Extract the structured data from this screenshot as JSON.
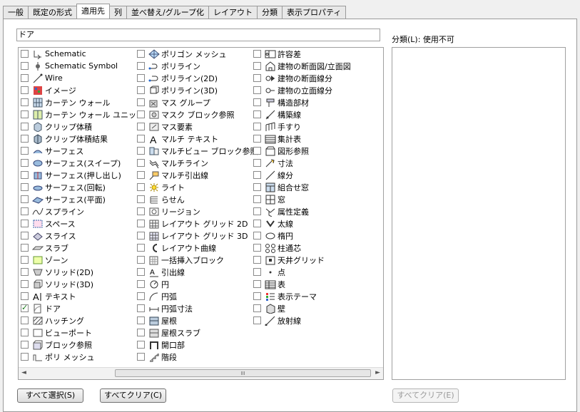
{
  "tabs": [
    "一般",
    "既定の形式",
    "適用先",
    "列",
    "並べ替え/グループ化",
    "レイアウト",
    "分類",
    "表示プロパティ"
  ],
  "active_tab": "適用先",
  "filter_value": "ドア",
  "columns": [
    [
      {
        "label": "Schematic",
        "icon": "schematic-icon",
        "checked": false
      },
      {
        "label": "Schematic Symbol",
        "icon": "schematic-symbol-icon",
        "checked": false
      },
      {
        "label": "Wire",
        "icon": "wire-icon",
        "checked": false
      },
      {
        "label": "イメージ",
        "icon": "image-icon",
        "checked": false
      },
      {
        "label": "カーテン ウォール",
        "icon": "curtain-wall-icon",
        "checked": false
      },
      {
        "label": "カーテン ウォール ユニット",
        "icon": "curtain-wall-unit-icon",
        "checked": false
      },
      {
        "label": "クリップ体積",
        "icon": "clip-volume-icon",
        "checked": false
      },
      {
        "label": "クリップ体積結果",
        "icon": "clip-volume-result-icon",
        "checked": false
      },
      {
        "label": "サーフェス",
        "icon": "surface-icon",
        "checked": false
      },
      {
        "label": "サーフェス(スイープ)",
        "icon": "surface-sweep-icon",
        "checked": false
      },
      {
        "label": "サーフェス(押し出し)",
        "icon": "surface-extrude-icon",
        "checked": false
      },
      {
        "label": "サーフェス(回転)",
        "icon": "surface-revolve-icon",
        "checked": false
      },
      {
        "label": "サーフェス(平面)",
        "icon": "surface-plane-icon",
        "checked": false
      },
      {
        "label": "スプライン",
        "icon": "spline-icon",
        "checked": false
      },
      {
        "label": "スペース",
        "icon": "space-icon",
        "checked": false
      },
      {
        "label": "スライス",
        "icon": "slice-icon",
        "checked": false
      },
      {
        "label": "スラブ",
        "icon": "slab-icon",
        "checked": false
      },
      {
        "label": "ゾーン",
        "icon": "zone-icon",
        "checked": false
      },
      {
        "label": "ソリッド(2D)",
        "icon": "solid-2d-icon",
        "checked": false
      },
      {
        "label": "ソリッド(3D)",
        "icon": "solid-3d-icon",
        "checked": false
      },
      {
        "label": "テキスト",
        "icon": "text-icon",
        "checked": false
      },
      {
        "label": "ドア",
        "icon": "door-icon",
        "checked": true
      },
      {
        "label": "ハッチング",
        "icon": "hatch-icon",
        "checked": false
      },
      {
        "label": "ビューポート",
        "icon": "viewport-icon",
        "checked": false
      },
      {
        "label": "ブロック参照",
        "icon": "block-reference-icon",
        "checked": false
      },
      {
        "label": "ポリ メッシュ",
        "icon": "poly-mesh-icon",
        "checked": false
      }
    ],
    [
      {
        "label": "ポリゴン メッシュ",
        "icon": "polygon-mesh-icon",
        "checked": false
      },
      {
        "label": "ポリライン",
        "icon": "polyline-icon",
        "checked": false
      },
      {
        "label": "ポリライン(2D)",
        "icon": "polyline-2d-icon",
        "checked": false
      },
      {
        "label": "ポリライン(3D)",
        "icon": "polyline-3d-icon",
        "checked": false
      },
      {
        "label": "マス グループ",
        "icon": "mass-group-icon",
        "checked": false
      },
      {
        "label": "マスク ブロック参照",
        "icon": "mask-block-icon",
        "checked": false
      },
      {
        "label": "マス要素",
        "icon": "mass-element-icon",
        "checked": false
      },
      {
        "label": "マルチ テキスト",
        "icon": "mtext-icon",
        "checked": false
      },
      {
        "label": "マルチビュー ブロック参照",
        "icon": "multiview-block-icon",
        "checked": false
      },
      {
        "label": "マルチライン",
        "icon": "multiline-icon",
        "checked": false
      },
      {
        "label": "マルチ引出線",
        "icon": "mleader-icon",
        "checked": false
      },
      {
        "label": "ライト",
        "icon": "light-icon",
        "checked": false
      },
      {
        "label": "らせん",
        "icon": "helix-icon",
        "checked": false
      },
      {
        "label": "リージョン",
        "icon": "region-icon",
        "checked": false
      },
      {
        "label": "レイアウト グリッド 2D",
        "icon": "layout-grid-2d-icon",
        "checked": false
      },
      {
        "label": "レイアウト グリッド 3D",
        "icon": "layout-grid-3d-icon",
        "checked": false
      },
      {
        "label": "レイアウト曲線",
        "icon": "layout-curve-icon",
        "checked": false
      },
      {
        "label": "一括挿入ブロック",
        "icon": "minsert-block-icon",
        "checked": false
      },
      {
        "label": "引出線",
        "icon": "leader-icon",
        "checked": false
      },
      {
        "label": "円",
        "icon": "circle-icon",
        "checked": false
      },
      {
        "label": "円弧",
        "icon": "arc-icon",
        "checked": false
      },
      {
        "label": "円弧寸法",
        "icon": "arc-dimension-icon",
        "checked": false
      },
      {
        "label": "屋根",
        "icon": "roof-icon",
        "checked": false
      },
      {
        "label": "屋根スラブ",
        "icon": "roof-slab-icon",
        "checked": false
      },
      {
        "label": "開口部",
        "icon": "opening-icon",
        "checked": false
      },
      {
        "label": "階段",
        "icon": "stair-icon",
        "checked": false
      }
    ],
    [
      {
        "label": "許容差",
        "icon": "tolerance-icon",
        "checked": false
      },
      {
        "label": "建物の断面図/立面図",
        "icon": "building-section-icon",
        "checked": false
      },
      {
        "label": "建物の断面線分",
        "icon": "section-line-icon",
        "checked": false
      },
      {
        "label": "建物の立面線分",
        "icon": "elevation-line-icon",
        "checked": false
      },
      {
        "label": "構造部材",
        "icon": "structural-member-icon",
        "checked": false
      },
      {
        "label": "構築線",
        "icon": "xline-icon",
        "checked": false
      },
      {
        "label": "手すり",
        "icon": "railing-icon",
        "checked": false
      },
      {
        "label": "集計表",
        "icon": "schedule-table-icon",
        "checked": false
      },
      {
        "label": "図形参照",
        "icon": "geometry-reference-icon",
        "checked": false
      },
      {
        "label": "寸法",
        "icon": "dimension-icon",
        "checked": false
      },
      {
        "label": "線分",
        "icon": "line-icon",
        "checked": false
      },
      {
        "label": "組合せ窓",
        "icon": "window-assembly-icon",
        "checked": false
      },
      {
        "label": "窓",
        "icon": "window-icon",
        "checked": false
      },
      {
        "label": "属性定義",
        "icon": "attribute-definition-icon",
        "checked": false
      },
      {
        "label": "太線",
        "icon": "trace-icon",
        "checked": false
      },
      {
        "label": "楕円",
        "icon": "ellipse-icon",
        "checked": false
      },
      {
        "label": "柱通芯",
        "icon": "column-grid-icon",
        "checked": false
      },
      {
        "label": "天井グリッド",
        "icon": "ceiling-grid-icon",
        "checked": false
      },
      {
        "label": "点",
        "icon": "point-icon",
        "checked": false
      },
      {
        "label": "表",
        "icon": "table-icon",
        "checked": false
      },
      {
        "label": "表示テーマ",
        "icon": "display-theme-icon",
        "checked": false
      },
      {
        "label": "壁",
        "icon": "wall-icon",
        "checked": false
      },
      {
        "label": "放射線",
        "icon": "ray-icon",
        "checked": false
      }
    ]
  ],
  "buttons": {
    "select_all": "すべて選択(S)",
    "clear_all": "すべてクリア(C)",
    "cat_clear_all": "すべてクリア(E)"
  },
  "category_label": "分類(L): 使用不可",
  "scrollbar": {
    "left_arrow": "◄",
    "right_arrow": "►",
    "thumb_grip": "III"
  }
}
